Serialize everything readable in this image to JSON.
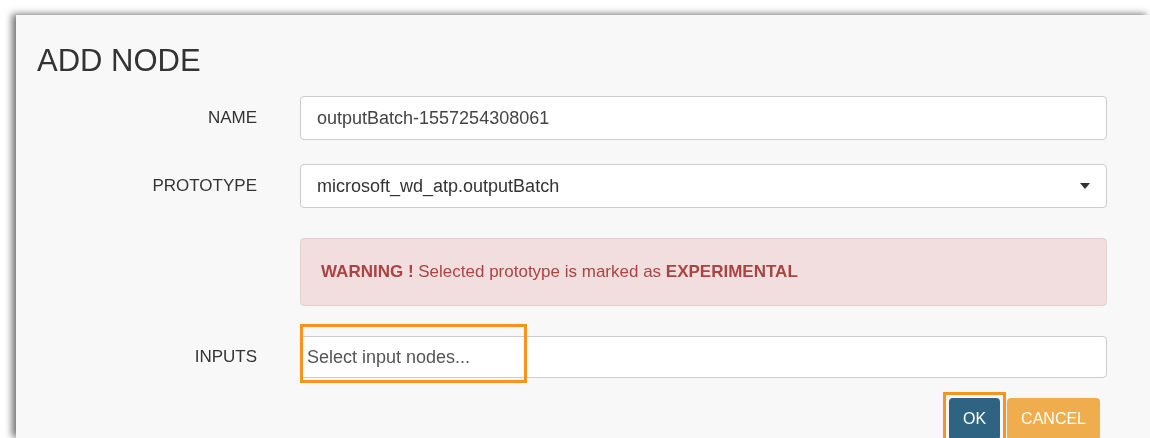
{
  "dialog": {
    "title": "ADD NODE"
  },
  "fields": [
    {
      "kind": "text",
      "label": "NAME",
      "value": "outputBatch-1557254308061",
      "highlighted": false
    },
    {
      "kind": "select",
      "label": "PROTOTYPE",
      "value": "microsoft_wd_atp.outputBatch",
      "highlighted": false
    },
    {
      "kind": "alert",
      "text": "**WARNING !** Selected prototype is marked as **EXPERIMENTAL**"
    },
    {
      "kind": "text",
      "label": "INPUTS",
      "placeholder": "Select input nodes...",
      "highlighted": true
    }
  ],
  "buttons": [
    {
      "kind": "primary",
      "label": "OK",
      "highlighted": true
    },
    {
      "kind": "warning",
      "label": "CANCEL",
      "highlighted": false
    }
  ]
}
